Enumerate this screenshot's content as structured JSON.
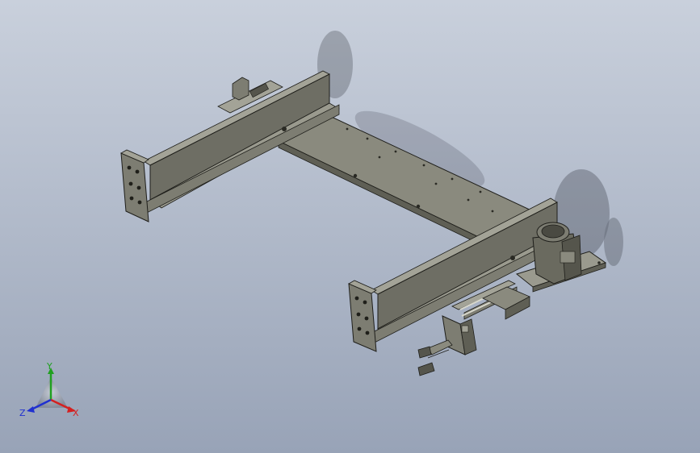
{
  "viewport": {
    "background_top": "#c9d0dc",
    "background_bottom": "#98a3b7"
  },
  "model": {
    "metal_color": "#7d7d72",
    "metal_dark": "#55554c",
    "metal_light": "#a3a397",
    "edge_color": "#1e1e1a",
    "shadow_color": "#2b2f3a"
  },
  "triad": {
    "x_label": "X",
    "y_label": "Y",
    "z_label": "Z",
    "x_color": "#d42020",
    "y_color": "#20a020",
    "z_color": "#2030d0"
  }
}
